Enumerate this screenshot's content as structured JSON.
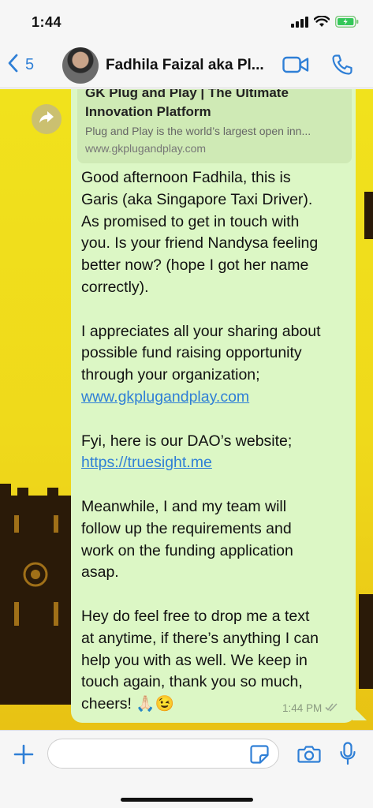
{
  "status_bar": {
    "time": "1:44"
  },
  "header": {
    "back_count": "5",
    "contact_name": "Fadhila Faizal aka Pl..."
  },
  "link_preview": {
    "title_line1": "GK Plug and Play | The Ultimate",
    "title_line2": "Innovation Platform",
    "description": "Plug and Play is the world’s largest open inn...",
    "url": "www.gkplugandplay.com"
  },
  "message": {
    "p1_l1": "Good afternoon Fadhila, this is",
    "p1_l2": "Garis (aka Singapore Taxi Driver).",
    "p1_l3": "As promised to get in touch with",
    "p1_l4": "you. Is your friend Nandysa feeling",
    "p1_l5": "better now? (hope I got her name",
    "p1_l6": "correctly).",
    "p2_l1": "I appreciates all your sharing about",
    "p2_l2": "possible fund raising opportunity",
    "p2_l3": "through your organization;",
    "p2_link": "www.gkplugandplay.com",
    "p3_l1": "Fyi, here is our DAO’s website;",
    "p3_link": "https://truesight.me",
    "p4_l1": "Meanwhile, I and my team will",
    "p4_l2": "follow up the requirements and",
    "p4_l3": "work on the funding application",
    "p4_l4": "asap.",
    "p5_l1": "Hey do feel free to drop me a text",
    "p5_l2": "at anytime, if there’s anything I can",
    "p5_l3": "help you with as well. We keep in",
    "p5_l4": "touch again, thank you so much,",
    "p5_l5": "cheers! 🙏🏻😉",
    "time": "1:44 PM"
  },
  "input": {
    "value": "",
    "placeholder": ""
  },
  "colors": {
    "accent": "#2f7fd6",
    "bubble": "#dcf7c5",
    "wallpaper": "#f1e21c"
  },
  "icons": [
    "signal-icon",
    "wifi-icon",
    "battery-icon",
    "back-chevron-icon",
    "video-call-icon",
    "phone-icon",
    "forward-icon",
    "read-receipt-icon",
    "plus-icon",
    "sticker-icon",
    "camera-icon",
    "microphone-icon"
  ]
}
